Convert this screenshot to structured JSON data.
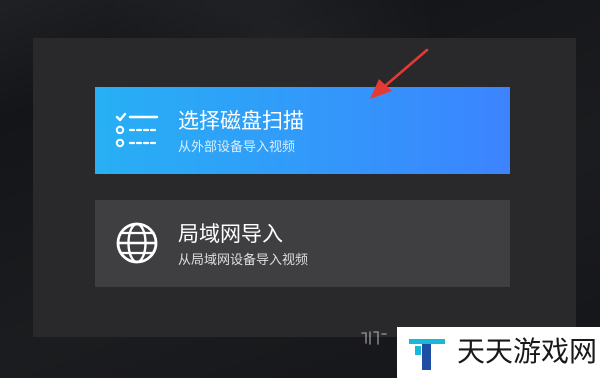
{
  "dialog": {
    "options": [
      {
        "title": "选择磁盘扫描",
        "subtitle": "从外部设备导入视频",
        "icon": "checklist-icon",
        "highlighted": true
      },
      {
        "title": "局域网导入",
        "subtitle": "从局域网设备导入视频",
        "icon": "globe-icon",
        "highlighted": false
      }
    ]
  },
  "annotation": {
    "icon": "red-arrow-icon"
  },
  "watermark": {
    "text": "天天游戏网",
    "icon": "t-logo-icon"
  },
  "colors": {
    "page_background": "#141518",
    "panel_background": "#29292b",
    "option_gradient_start": "#27b0f4",
    "option_gradient_end": "#3c84ff",
    "secondary_option_background": "#3f3f42",
    "arrow": "#e53935",
    "watermark_logo_primary": "#19b7d8",
    "watermark_logo_secondary": "#1d4ea3"
  }
}
